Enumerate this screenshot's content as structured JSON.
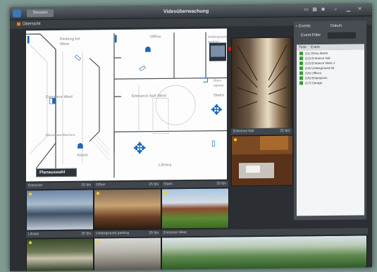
{
  "window": {
    "title": "Videoüberwachung",
    "session_button": "Session",
    "panel_label": "Übersicht"
  },
  "map": {
    "labels": [
      "Parking lot West",
      "Office",
      "Underground parking",
      "Entrance West",
      "Entrance hall West",
      "Stairs",
      "Door-opener",
      "Microwave Barriers",
      "Alarm",
      "Library"
    ],
    "plan_button": "Planauswahl"
  },
  "cameras": {
    "bar_labels": [
      "Entrance hall",
      "Entrance",
      "Office",
      "Stairs",
      "Library",
      "Underground parking",
      "Entrance West"
    ],
    "fps": "25 fps"
  },
  "events_panel": {
    "mode": "Events",
    "date_label": "Datum",
    "filter_label": "Event-Filter",
    "col_time": "Time",
    "col_event": "Event",
    "events": [
      "(11) Entry Alarm",
      "(12) Entrance hall",
      "(13) Entrance West 1",
      "(14) Underground lot",
      "(15) Offices",
      "(16) Employees",
      "(17) Garage"
    ]
  },
  "colors": {
    "accent_blue": "#1e66b4",
    "alarm_red": "#e01010",
    "status_green": "#2fa02f",
    "status_yellow": "#f4d21a"
  }
}
